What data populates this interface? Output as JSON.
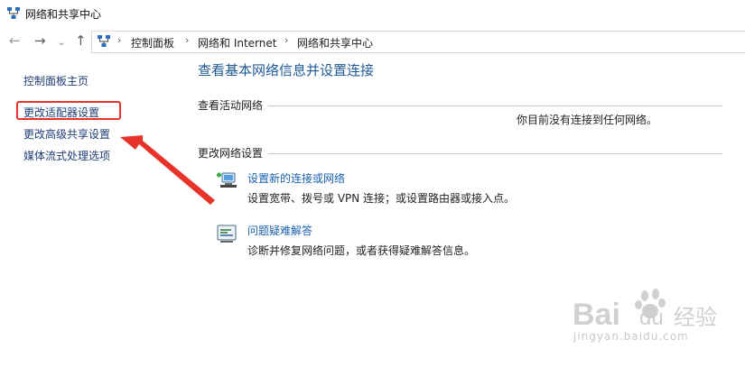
{
  "window": {
    "title": "网络和共享中心"
  },
  "address": {
    "crumbs": [
      "控制面板",
      "网络和 Internet",
      "网络和共享中心"
    ]
  },
  "sidebar": {
    "items": [
      {
        "label": "控制面板主页"
      },
      {
        "label": "更改适配器设置"
      },
      {
        "label": "更改高级共享设置"
      },
      {
        "label": "媒体流式处理选项"
      }
    ]
  },
  "main": {
    "heading": "查看基本网络信息并设置连接",
    "active_networks": {
      "label": "查看活动网络",
      "status": "你目前没有连接到任何网络。"
    },
    "change_settings": {
      "label": "更改网络设置",
      "tasks": [
        {
          "link": "设置新的连接或网络",
          "desc": "设置宽带、拨号或 VPN 连接；或设置路由器或接入点。",
          "icon": "network-setup-icon"
        },
        {
          "link": "问题疑难解答",
          "desc": "诊断并修复网络问题，或者获得疑难解答信息。",
          "icon": "troubleshoot-icon"
        }
      ]
    }
  },
  "annotations": {
    "highlight_color": "#e8332a"
  },
  "watermark": {
    "brand": "Bai 经验",
    "url": "jingyan.baidu.com"
  }
}
